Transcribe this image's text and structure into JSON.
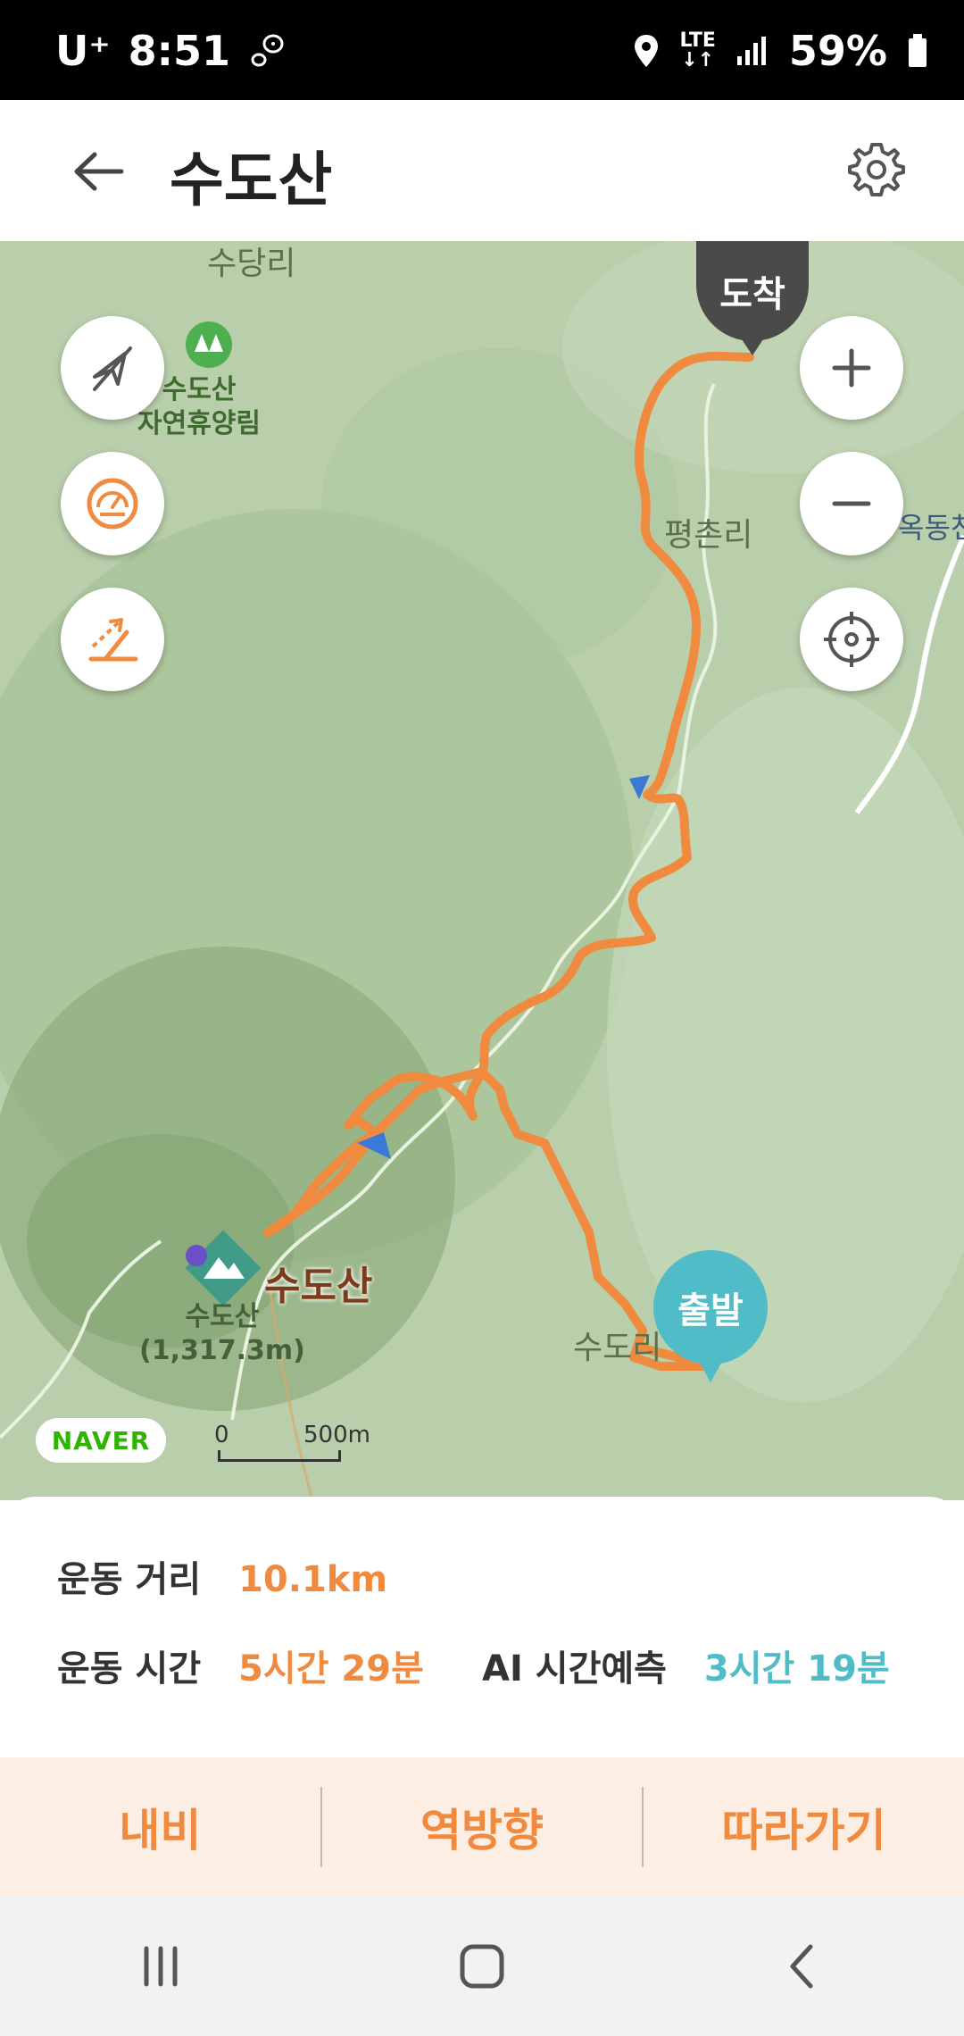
{
  "status_bar": {
    "carrier": "U⁺",
    "time": "8:51",
    "network_top": "LTE",
    "network_bottom": "↓↑",
    "battery": "59%"
  },
  "header": {
    "title": "수도산"
  },
  "map": {
    "labels": {
      "sudang_ri": "수당리",
      "pyeongchon_ri": "평촌리",
      "okdong": "옥동천",
      "sudo_ri": "수도리",
      "forest_name": "수도산\n자연휴양림",
      "peak_name": "수도산\n(1,317.3m)",
      "mountain_title": "수도산"
    },
    "marker_arrive": "도착",
    "marker_start": "출발",
    "naver": "NAVER",
    "scale_zero": "0",
    "scale_distance": "500m",
    "route_color": "#ef8a3f"
  },
  "stats": {
    "distance_label": "운동 거리",
    "distance_value": "10.1km",
    "time_label": "운동 시간",
    "time_value": "5시간 29분",
    "ai_label": "AI 시간예측",
    "ai_value": "3시간 19분"
  },
  "actions": {
    "navi": "내비",
    "reverse": "역방향",
    "follow": "따라가기"
  },
  "colors": {
    "accent_orange": "#ef8a3f",
    "accent_teal": "#4fbcc7",
    "arrive_marker": "#4a4a4a"
  }
}
